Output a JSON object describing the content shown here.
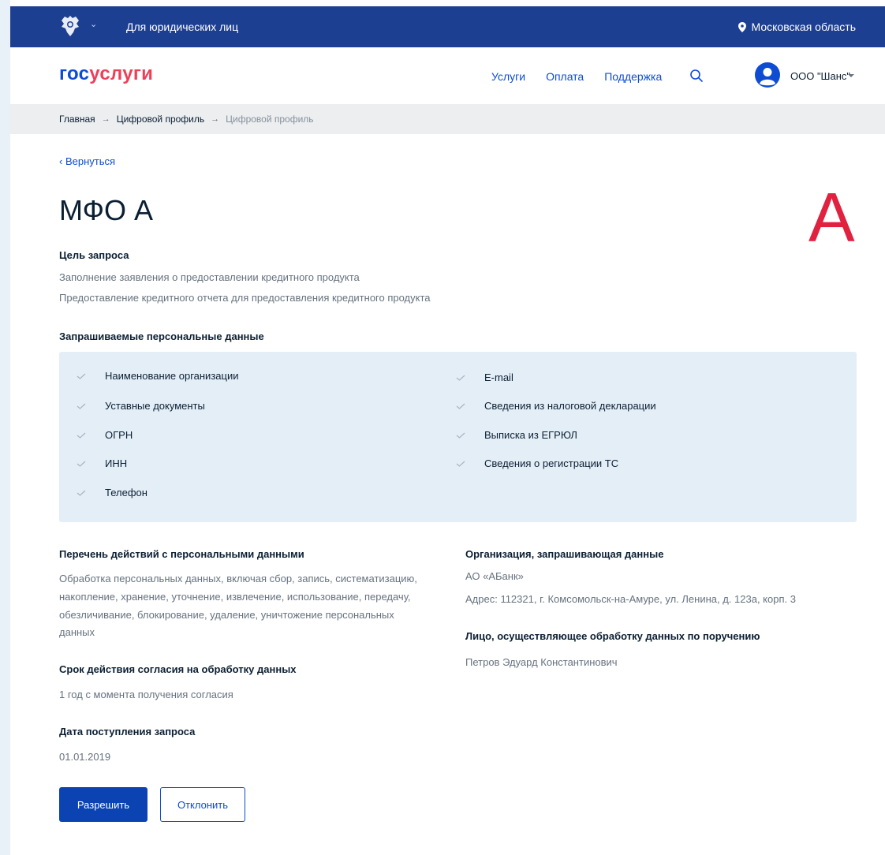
{
  "topbar": {
    "legal_link": "Для юридических лиц",
    "region": "Московская область",
    "emblem_icon": "coat-of-arms-icon",
    "region_icon": "location-pin-icon"
  },
  "header": {
    "logo_part1": "гос",
    "logo_part2": "услуги",
    "nav": [
      "Услуги",
      "Оплата",
      "Поддержка"
    ],
    "search_icon": "search-icon",
    "org_name": "ООО \"Шанс\""
  },
  "breadcrumb": [
    "Главная",
    "Цифровой профиль",
    "Цифровой профиль"
  ],
  "back_label": "Вернуться",
  "title": "МФО А",
  "logo_letter": "А",
  "purpose": {
    "heading": "Цель запроса",
    "lines": [
      "Заполнение заявления о предоставлении кредитного продукта",
      "Предоставление кредитного отчета для предоставления кредитного продукта"
    ]
  },
  "requested": {
    "heading": "Запрашиваемые персональные данные",
    "left": [
      "Наименование организации",
      "Уставные документы",
      "ОГРН",
      "ИНН",
      "Телефон"
    ],
    "right": [
      "E-mail",
      "Сведения из налоговой декларации",
      "Выписка из ЕГРЮЛ",
      "Сведения о регистрации ТС"
    ]
  },
  "actions": {
    "heading": "Перечень действий с персональными данными",
    "lines": [
      "Обработка персональных данных, включая сбор, запись, систематизацию,",
      "накопление, хранение, уточнение, извлечение, использование, передачу,",
      "обезличивание, блокирование, удаление, уничтожение персональных",
      "данных"
    ]
  },
  "term": {
    "heading": "Срок действия согласия на обработку данных",
    "value": "1 год с момента получения согласия"
  },
  "received": {
    "heading": "Дата поступления запроса",
    "value": "01.01.2019"
  },
  "organization": {
    "heading": "Организация, запрашивающая данные",
    "name": "АО «АБанк»",
    "address": "Адрес: 112321, г. Комсомольск-на-Амуре, ул. Ленина, д. 123а, корп. 3"
  },
  "processor": {
    "heading": "Лицо, осуществляющее обработку данных по поручению",
    "name": "Петров Эдуард Константинович"
  },
  "buttons": {
    "allow": "Разрешить",
    "deny": "Отклонить"
  },
  "colors": {
    "primary": "#0d4cd3",
    "topbar": "#1d3f91",
    "logo_red": "#ee3f58",
    "letter_red": "#e0213f",
    "box_bg": "#e4eef7"
  }
}
